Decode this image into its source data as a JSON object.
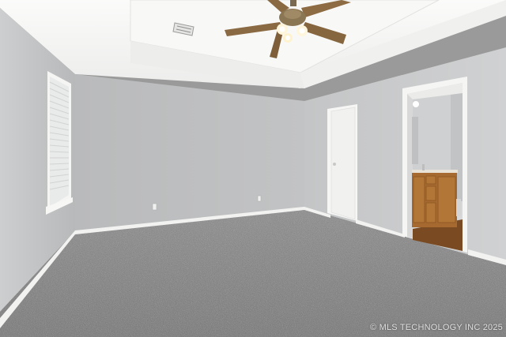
{
  "photo": {
    "scene": "empty-bedroom-interior",
    "watermark": "© MLS TECHNOLOGY INC 2025"
  },
  "colors": {
    "ceiling": "#f2f2f1",
    "ceiling_tray": "#f7f7f6",
    "wall_left": "#c3c4c5",
    "wall_back": "#bdbebf",
    "wall_right": "#cacbcc",
    "trim": "#f4f4f3",
    "door": "#f3f3f2",
    "carpet": "#7b7b7c",
    "vanity_wood": "#a66a30",
    "floor_wood": "#7a4a22"
  },
  "objects": [
    "ceiling-fan-icon",
    "hvac-vent-icon",
    "window",
    "closed-door",
    "bathroom-doorway",
    "vanity-cabinet",
    "carpet-floor",
    "electrical-outlet-icon"
  ]
}
